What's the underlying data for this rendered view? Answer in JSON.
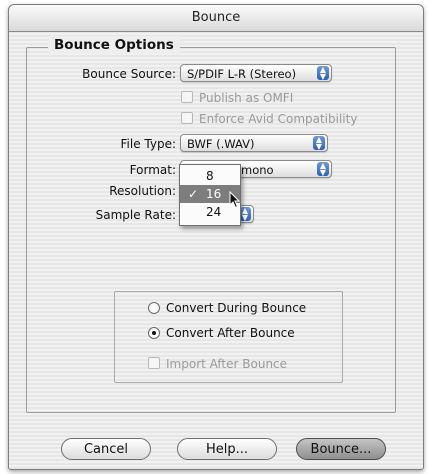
{
  "window": {
    "title": "Bounce"
  },
  "options": {
    "group_title": "Bounce Options",
    "bounce_source_label": "Bounce Source:",
    "bounce_source_value": "S/PDIF L-R (Stereo)",
    "publish_omfi_label": "Publish as OMFI",
    "enforce_avid_label": "Enforce Avid Compatibility",
    "file_type_label": "File Type:",
    "file_type_value": "BWF (.WAV)",
    "format_label": "Format:",
    "format_value": "mono",
    "resolution_label": "Resolution:",
    "sample_rate_label": "Sample Rate:"
  },
  "resolution_menu": {
    "items": [
      "8",
      "16",
      "24"
    ],
    "selected": "16",
    "check_mark": "✓"
  },
  "convert": {
    "during_label": "Convert During Bounce",
    "after_label": "Convert After Bounce",
    "selected": "Convert After Bounce",
    "import_after_label": "Import After Bounce"
  },
  "buttons": {
    "cancel": "Cancel",
    "help": "Help...",
    "bounce": "Bounce..."
  }
}
